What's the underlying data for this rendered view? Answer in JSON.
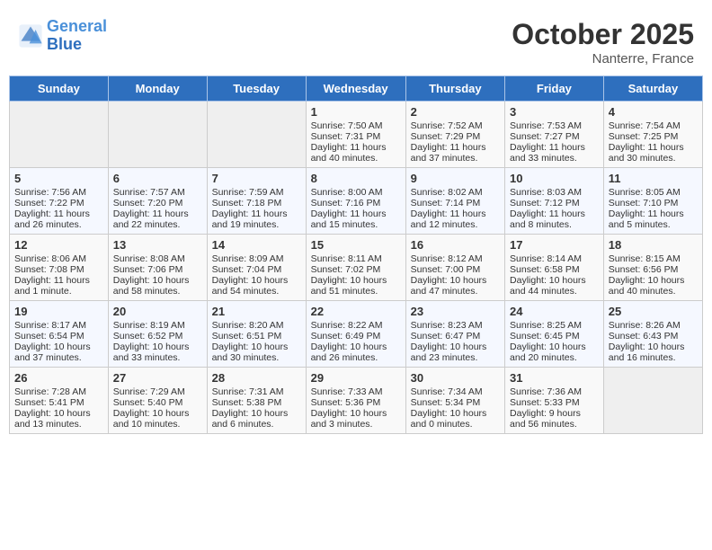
{
  "header": {
    "logo_line1": "General",
    "logo_line2": "Blue",
    "month": "October 2025",
    "location": "Nanterre, France"
  },
  "weekdays": [
    "Sunday",
    "Monday",
    "Tuesday",
    "Wednesday",
    "Thursday",
    "Friday",
    "Saturday"
  ],
  "weeks": [
    [
      {
        "num": "",
        "info": ""
      },
      {
        "num": "",
        "info": ""
      },
      {
        "num": "",
        "info": ""
      },
      {
        "num": "1",
        "info": "Sunrise: 7:50 AM\nSunset: 7:31 PM\nDaylight: 11 hours\nand 40 minutes."
      },
      {
        "num": "2",
        "info": "Sunrise: 7:52 AM\nSunset: 7:29 PM\nDaylight: 11 hours\nand 37 minutes."
      },
      {
        "num": "3",
        "info": "Sunrise: 7:53 AM\nSunset: 7:27 PM\nDaylight: 11 hours\nand 33 minutes."
      },
      {
        "num": "4",
        "info": "Sunrise: 7:54 AM\nSunset: 7:25 PM\nDaylight: 11 hours\nand 30 minutes."
      }
    ],
    [
      {
        "num": "5",
        "info": "Sunrise: 7:56 AM\nSunset: 7:22 PM\nDaylight: 11 hours\nand 26 minutes."
      },
      {
        "num": "6",
        "info": "Sunrise: 7:57 AM\nSunset: 7:20 PM\nDaylight: 11 hours\nand 22 minutes."
      },
      {
        "num": "7",
        "info": "Sunrise: 7:59 AM\nSunset: 7:18 PM\nDaylight: 11 hours\nand 19 minutes."
      },
      {
        "num": "8",
        "info": "Sunrise: 8:00 AM\nSunset: 7:16 PM\nDaylight: 11 hours\nand 15 minutes."
      },
      {
        "num": "9",
        "info": "Sunrise: 8:02 AM\nSunset: 7:14 PM\nDaylight: 11 hours\nand 12 minutes."
      },
      {
        "num": "10",
        "info": "Sunrise: 8:03 AM\nSunset: 7:12 PM\nDaylight: 11 hours\nand 8 minutes."
      },
      {
        "num": "11",
        "info": "Sunrise: 8:05 AM\nSunset: 7:10 PM\nDaylight: 11 hours\nand 5 minutes."
      }
    ],
    [
      {
        "num": "12",
        "info": "Sunrise: 8:06 AM\nSunset: 7:08 PM\nDaylight: 11 hours\nand 1 minute."
      },
      {
        "num": "13",
        "info": "Sunrise: 8:08 AM\nSunset: 7:06 PM\nDaylight: 10 hours\nand 58 minutes."
      },
      {
        "num": "14",
        "info": "Sunrise: 8:09 AM\nSunset: 7:04 PM\nDaylight: 10 hours\nand 54 minutes."
      },
      {
        "num": "15",
        "info": "Sunrise: 8:11 AM\nSunset: 7:02 PM\nDaylight: 10 hours\nand 51 minutes."
      },
      {
        "num": "16",
        "info": "Sunrise: 8:12 AM\nSunset: 7:00 PM\nDaylight: 10 hours\nand 47 minutes."
      },
      {
        "num": "17",
        "info": "Sunrise: 8:14 AM\nSunset: 6:58 PM\nDaylight: 10 hours\nand 44 minutes."
      },
      {
        "num": "18",
        "info": "Sunrise: 8:15 AM\nSunset: 6:56 PM\nDaylight: 10 hours\nand 40 minutes."
      }
    ],
    [
      {
        "num": "19",
        "info": "Sunrise: 8:17 AM\nSunset: 6:54 PM\nDaylight: 10 hours\nand 37 minutes."
      },
      {
        "num": "20",
        "info": "Sunrise: 8:19 AM\nSunset: 6:52 PM\nDaylight: 10 hours\nand 33 minutes."
      },
      {
        "num": "21",
        "info": "Sunrise: 8:20 AM\nSunset: 6:51 PM\nDaylight: 10 hours\nand 30 minutes."
      },
      {
        "num": "22",
        "info": "Sunrise: 8:22 AM\nSunset: 6:49 PM\nDaylight: 10 hours\nand 26 minutes."
      },
      {
        "num": "23",
        "info": "Sunrise: 8:23 AM\nSunset: 6:47 PM\nDaylight: 10 hours\nand 23 minutes."
      },
      {
        "num": "24",
        "info": "Sunrise: 8:25 AM\nSunset: 6:45 PM\nDaylight: 10 hours\nand 20 minutes."
      },
      {
        "num": "25",
        "info": "Sunrise: 8:26 AM\nSunset: 6:43 PM\nDaylight: 10 hours\nand 16 minutes."
      }
    ],
    [
      {
        "num": "26",
        "info": "Sunrise: 7:28 AM\nSunset: 5:41 PM\nDaylight: 10 hours\nand 13 minutes."
      },
      {
        "num": "27",
        "info": "Sunrise: 7:29 AM\nSunset: 5:40 PM\nDaylight: 10 hours\nand 10 minutes."
      },
      {
        "num": "28",
        "info": "Sunrise: 7:31 AM\nSunset: 5:38 PM\nDaylight: 10 hours\nand 6 minutes."
      },
      {
        "num": "29",
        "info": "Sunrise: 7:33 AM\nSunset: 5:36 PM\nDaylight: 10 hours\nand 3 minutes."
      },
      {
        "num": "30",
        "info": "Sunrise: 7:34 AM\nSunset: 5:34 PM\nDaylight: 10 hours\nand 0 minutes."
      },
      {
        "num": "31",
        "info": "Sunrise: 7:36 AM\nSunset: 5:33 PM\nDaylight: 9 hours\nand 56 minutes."
      },
      {
        "num": "",
        "info": ""
      }
    ]
  ]
}
